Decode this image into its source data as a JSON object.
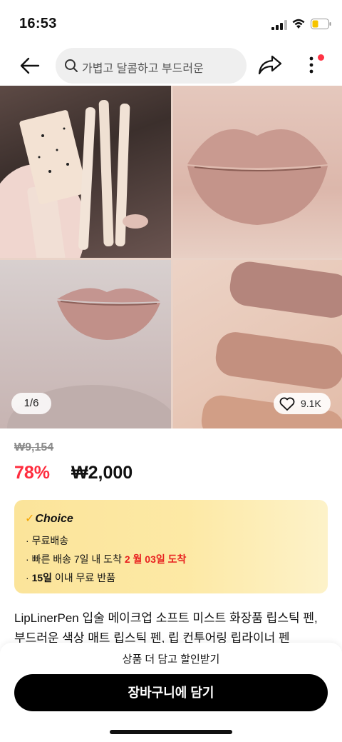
{
  "status_bar": {
    "time": "16:53"
  },
  "header": {
    "search_placeholder": "가볍고 달콤하고 부드러운"
  },
  "gallery": {
    "counter": "1/6",
    "likes": "9.1K"
  },
  "pricing": {
    "original": "₩9,154",
    "discount": "78%",
    "price": "₩2,000"
  },
  "choice": {
    "badge": "Choice",
    "items": [
      {
        "text": "무료배송"
      },
      {
        "prefix": "빠른 배송 7일 내 도착 ",
        "highlight": "2 월 03일 도착"
      },
      {
        "bold": "15일",
        "suffix": " 이내  무료 반품"
      }
    ]
  },
  "product": {
    "title": "LipLinerPen 입술 메이크업 소프트 미스트 화장품 립스틱 펜, 부드러운 색상 매트 립스틱 펜, 립 컨투어링 립라이너 펜"
  },
  "bottom": {
    "promo": "상품 더 담고 할인받기",
    "cart_button": "장바구니에 담기"
  },
  "colors": {
    "accent_red": "#ff2d3f",
    "choice_yellow": "#fbe49a",
    "button_black": "#000000"
  }
}
